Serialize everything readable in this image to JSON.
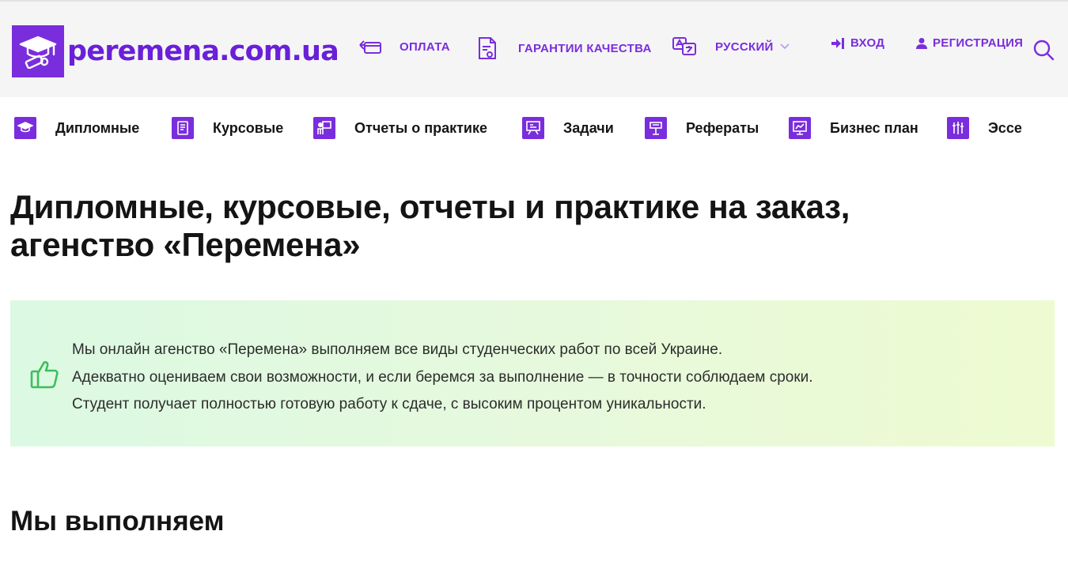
{
  "header": {
    "logo_text": "peremena.com.ua",
    "nav": {
      "payment": "ОПЛАТА",
      "quality": "ГАРАНТИИ КАЧЕСТВА",
      "language": "РУССКИЙ",
      "login": "ВХОД",
      "register": "РЕГИСТРАЦИЯ"
    },
    "icons": [
      "payment-icon",
      "certificate-icon",
      "translate-icon",
      "chevron-down-icon",
      "sign-in-icon",
      "user-icon",
      "search-icon"
    ]
  },
  "categories": [
    {
      "label": "Дипломные",
      "icon": "graduation-cap-icon"
    },
    {
      "label": "Курсовые",
      "icon": "book-icon"
    },
    {
      "label": "Отчеты о практике",
      "icon": "presenter-icon"
    },
    {
      "label": "Задачи",
      "icon": "board-icon"
    },
    {
      "label": "Рефераты",
      "icon": "lectern-icon"
    },
    {
      "label": "Бизнес план",
      "icon": "chart-board-icon"
    },
    {
      "label": "Эссе",
      "icon": "pens-icon"
    }
  ],
  "main": {
    "title_line1": "Дипломные, курсовые, отчеты и практике на заказ,",
    "title_line2": "агенство «Перемена»",
    "info_lines": [
      "Мы онлайн агенство «Перемена» выполняем все виды студенческих работ по всей Украине.",
      "Адекватно оцениваем свои возможности, и если беремся за выполнение — в точности соблюдаем сроки.",
      "Студент получает полностью готовую работу к сдаче, с высоким процентом уникальности."
    ],
    "section_title": "Мы выполняем"
  },
  "colors": {
    "brand": "#7a2ddd",
    "header_bg": "#f5f5f6",
    "thumb": "#3cbf5a"
  }
}
